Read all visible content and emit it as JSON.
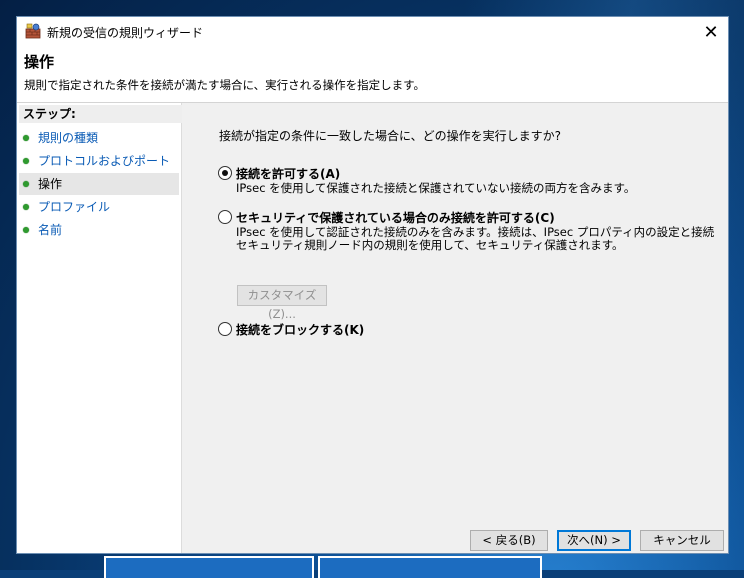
{
  "window": {
    "title": "新規の受信の規則ウィザード",
    "close_glyph": "✕"
  },
  "header": {
    "title": "操作",
    "description": "規則で指定された条件を接続が満たす場合に、実行される操作を指定します。"
  },
  "sidebar": {
    "steps_label": "ステップ:",
    "items": [
      {
        "label": "規則の種類",
        "state": "link"
      },
      {
        "label": "プロトコルおよびポート",
        "state": "link"
      },
      {
        "label": "操作",
        "state": "current"
      },
      {
        "label": "プロファイル",
        "state": "link"
      },
      {
        "label": "名前",
        "state": "link"
      }
    ]
  },
  "main": {
    "question": "接続が指定の条件に一致した場合に、どの操作を実行しますか?",
    "options": [
      {
        "label": "接続を許可する(A)",
        "description": [
          "IPsec を使用して保護された接続と保護されていない接続の両方を含みます。"
        ],
        "checked": true
      },
      {
        "label": "セキュリティで保護されている場合のみ接続を許可する(C)",
        "description": [
          "IPsec を使用して認証された接続のみを含みます。接続は、IPsec プロパティ内の設定と接続",
          "セキュリティ規則ノード内の規則を使用して、セキュリティ保護されます。"
        ],
        "checked": false
      },
      {
        "label": "接続をブロックする(K)",
        "description": [],
        "checked": false
      }
    ],
    "customize_label": "カスタマイズ(Z)..."
  },
  "buttons": {
    "back": "< 戻る(B)",
    "next": "次へ(N) >",
    "cancel": "キャンセル"
  },
  "colors": {
    "link": "#0a5bb5",
    "step_dot": "#2f9a2f",
    "default_button_border": "#0078d7"
  },
  "icons": {
    "app": "firewall-wall-icon",
    "close": "close-icon",
    "step": "green-dot-icon"
  }
}
